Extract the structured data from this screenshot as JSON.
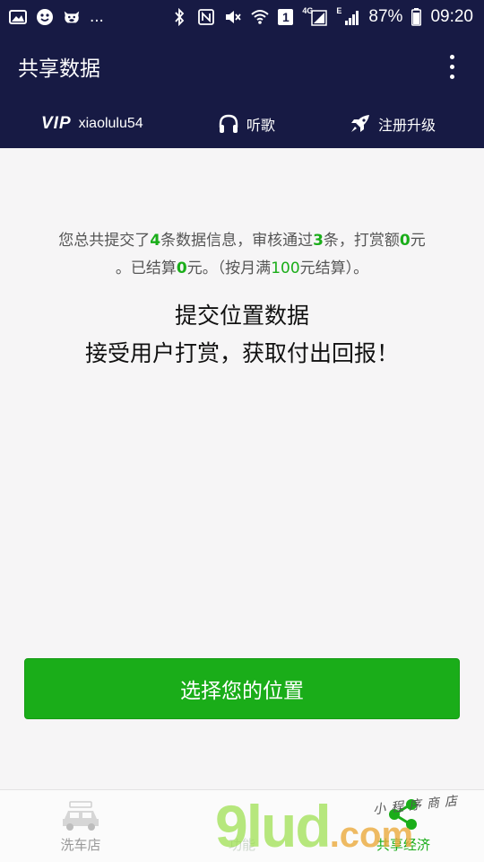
{
  "status_bar": {
    "notification_icons": [
      "image-icon",
      "emoji-icon",
      "cow-icon"
    ],
    "more_indicator": "...",
    "system_icons": [
      "bluetooth-icon",
      "nfc-icon",
      "mute-icon",
      "wifi-icon",
      "sim-1-icon",
      "signal-4g-icon",
      "signal-e-icon"
    ],
    "sim_label": "1",
    "network_4g": "4G",
    "network_e": "E",
    "battery": "87%",
    "time": "09:20"
  },
  "app_bar": {
    "title": "共享数据",
    "menu_icon": "more-vertical-icon"
  },
  "user_bar": {
    "vip_label": "VIP",
    "username": "xiaolulu54",
    "music_label": "听歌",
    "music_icon": "headphones-icon",
    "upgrade_label": "注册升级",
    "upgrade_icon": "rocket-icon"
  },
  "summary": {
    "part1": "您总共提交了",
    "submitted_count": "4",
    "part2": "条数据信息，审核通过",
    "approved_count": "3",
    "part3": "条，打赏额",
    "reward_amount": "0",
    "part4": "元",
    "part5": "。已结算",
    "settled_amount": "0",
    "part6": "元。（按月满",
    "threshold": "100",
    "part7": "元结算）。"
  },
  "headline": {
    "line1": "提交位置数据",
    "line2": "接受用户打赏，获取付出回报！"
  },
  "primary_button": {
    "label": "选择您的位置"
  },
  "bottom_nav": {
    "tabs": [
      {
        "label": "洗车店",
        "icon": "car-wash-icon",
        "active": false
      },
      {
        "label": "功能",
        "icon": "",
        "active": false
      },
      {
        "label": "共享经济",
        "icon": "share-icon",
        "active": true
      }
    ]
  },
  "watermark": {
    "text": "9lud",
    "suffix": ".com",
    "tagline": "小程序商店"
  },
  "colors": {
    "header_bg": "#171a44",
    "accent_green": "#1aad19",
    "page_bg": "#f6f5f6"
  }
}
